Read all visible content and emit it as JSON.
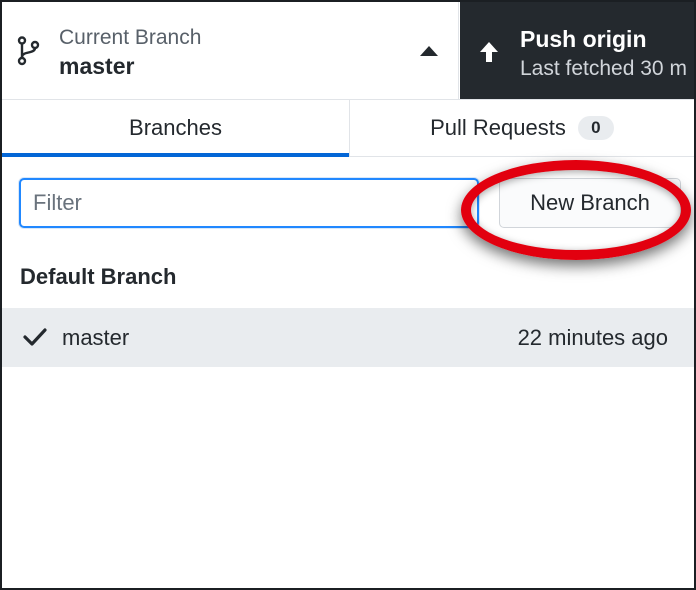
{
  "toolbar": {
    "current_branch": {
      "caption": "Current Branch",
      "name": "master",
      "icon": "git-branch-icon"
    },
    "push": {
      "title": "Push origin",
      "subtitle": "Last fetched 30 m",
      "icon": "arrow-up-icon"
    }
  },
  "tabs": [
    {
      "label": "Branches",
      "active": true
    },
    {
      "label": "Pull Requests",
      "count": "0",
      "active": false
    }
  ],
  "filter": {
    "placeholder": "Filter",
    "value": ""
  },
  "new_branch_label": "New Branch",
  "sections": {
    "default_title": "Default Branch"
  },
  "branches": [
    {
      "name": "master",
      "time": "22 minutes ago",
      "checked": true
    }
  ],
  "colors": {
    "push_bg": "#24292e",
    "tab_underline": "#0366d6",
    "focus_border": "#2188ff",
    "selected_row": "#e9ecef",
    "annotation_red": "#e2000f"
  }
}
